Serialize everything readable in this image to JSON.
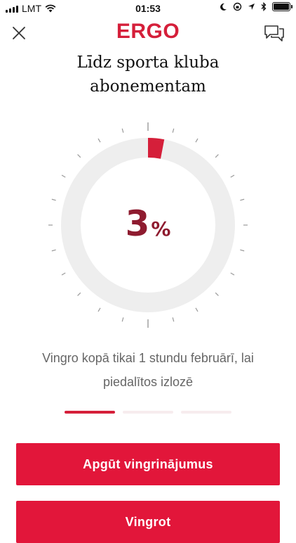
{
  "status_bar": {
    "carrier": "LMT",
    "time": "01:53"
  },
  "header": {
    "logo": "ERGO",
    "close_icon": "close-icon",
    "chat_icon": "chat-bubbles-icon"
  },
  "goal": {
    "title": "Līdz sporta kluba abonementam",
    "progress_percent": 3,
    "percent_value": "3",
    "percent_sign": "%",
    "accent_color": "#d51f3a",
    "track_color": "#eeeeee"
  },
  "message": {
    "text": "Vingro kopā tikai 1 stundu februārī, lai piedalītos izlozē"
  },
  "pager": {
    "pages": 3,
    "active_index": 0
  },
  "actions": {
    "primary_label": "Apgūt vingrinājumus",
    "secondary_label": "Vingrot"
  }
}
